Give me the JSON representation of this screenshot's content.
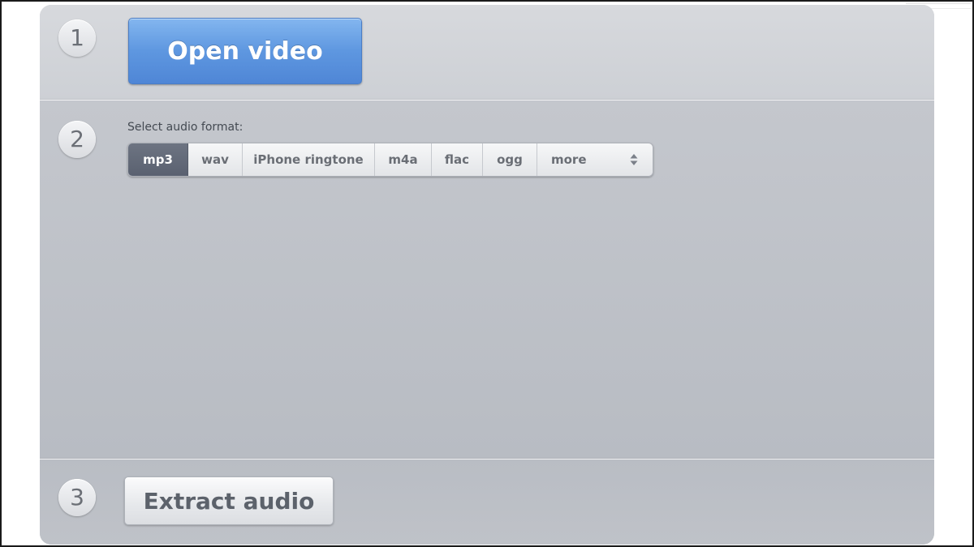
{
  "steps": {
    "one": "1",
    "two": "2",
    "three": "3"
  },
  "open_button": {
    "label": "Open video"
  },
  "format_selector": {
    "label": "Select audio format:",
    "selected": "mp3",
    "options": [
      "mp3",
      "wav",
      "iPhone ringtone",
      "m4a",
      "flac",
      "ogg",
      "more"
    ]
  },
  "extract_button": {
    "label": "Extract audio"
  },
  "colors": {
    "accent_blue": "#5e97e0",
    "active_tab": "#5a6170",
    "panel_bg": "#bfc3ca"
  },
  "icons": {
    "more_dropdown": "updown-arrows-icon"
  }
}
